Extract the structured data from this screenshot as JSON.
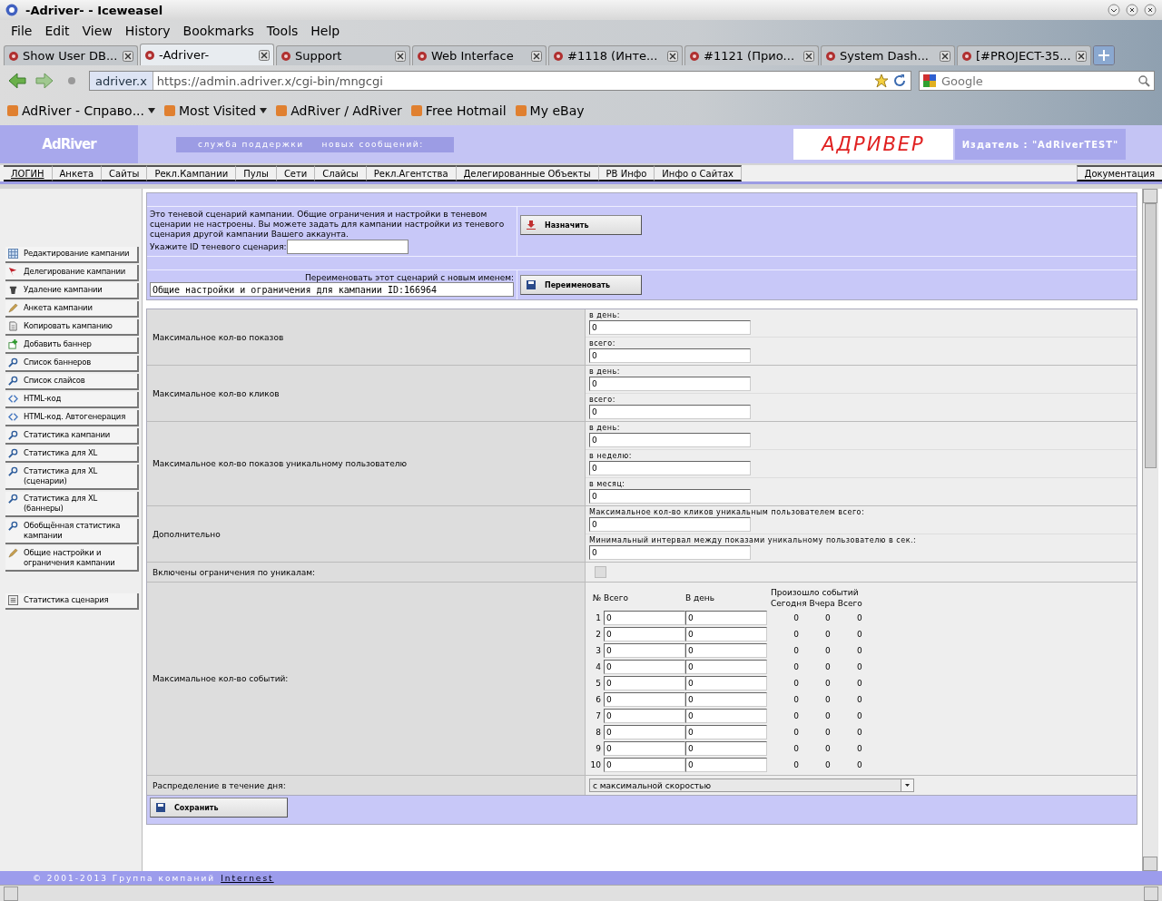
{
  "window": {
    "title": "-Adriver- - Iceweasel"
  },
  "menu": [
    "File",
    "Edit",
    "View",
    "History",
    "Bookmarks",
    "Tools",
    "Help"
  ],
  "tabs": [
    {
      "label": "Show User DB...",
      "selected": false
    },
    {
      "label": "-Adriver-",
      "selected": true
    },
    {
      "label": "Support",
      "selected": false
    },
    {
      "label": "Web Interface",
      "selected": false
    },
    {
      "label": "#1118 (Инте...",
      "selected": false
    },
    {
      "label": "#1121 (Прио...",
      "selected": false
    },
    {
      "label": "System Dash...",
      "selected": false
    },
    {
      "label": "[#PROJECT-35...",
      "selected": false
    }
  ],
  "address": {
    "site": "adriver.x",
    "url": "https://admin.adriver.x/cgi-bin/mngcgi"
  },
  "search": {
    "placeholder": "Google"
  },
  "bookmarks": [
    {
      "label": "AdRiver - Справо...",
      "has_menu": true
    },
    {
      "label": "Most Visited",
      "has_menu": true
    },
    {
      "label": "AdRiver / AdRiver",
      "has_menu": false
    },
    {
      "label": "Free Hotmail",
      "has_menu": false
    },
    {
      "label": "My eBay",
      "has_menu": false
    }
  ],
  "header": {
    "logo": "AdRiver",
    "support": "служба поддержки",
    "messages": "новых сообщений:",
    "brand": "АДРИВЕР",
    "publisher": "Издатель : \"AdRiverTEST\""
  },
  "nav": {
    "items": [
      {
        "label": "ЛОГИН",
        "selected": true
      },
      {
        "label": "Анкета",
        "selected": false
      },
      {
        "label": "Сайты",
        "selected": false
      },
      {
        "label": "Рекл.Кампании",
        "selected": false
      },
      {
        "label": "Пулы",
        "selected": false
      },
      {
        "label": "Сети",
        "selected": false
      },
      {
        "label": "Слайсы",
        "selected": false
      },
      {
        "label": "Рекл.Агентства",
        "selected": false
      },
      {
        "label": "Делегированные Объекты",
        "selected": false
      },
      {
        "label": "РВ Инфо",
        "selected": false
      },
      {
        "label": "Инфо о Сайтах",
        "selected": false
      }
    ],
    "docs": "Документация"
  },
  "sidebar": {
    "items": [
      {
        "label": "Редактирование кампании",
        "kind": "grid"
      },
      {
        "label": "Делегирование кампании",
        "kind": "flag"
      },
      {
        "label": "Удаление кампании",
        "kind": "trash"
      },
      {
        "label": "Анкета кампании",
        "kind": "pencil"
      },
      {
        "label": "Копировать кампанию",
        "kind": "page"
      },
      {
        "label": "Добавить баннер",
        "kind": "add"
      },
      {
        "label": "Список баннеров",
        "kind": "search"
      },
      {
        "label": "Список слайсов",
        "kind": "search"
      },
      {
        "label": "HTML-код",
        "kind": "code"
      },
      {
        "label": "HTML-код. Автогенерация",
        "kind": "code"
      },
      {
        "label": "Статистика кампании",
        "kind": "search"
      },
      {
        "label": "Статистика для XL",
        "kind": "search"
      },
      {
        "label": "Статистика для XL (сценарии)",
        "kind": "search"
      },
      {
        "label": "Статистика для XL (баннеры)",
        "kind": "search"
      },
      {
        "label": "Обобщённая статистика кампании",
        "kind": "search"
      },
      {
        "label": "Общие настройки и ограничения кампании",
        "kind": "pencil"
      }
    ],
    "extra_items": [
      {
        "label": "Статистика сценария",
        "kind": "list"
      }
    ]
  },
  "shadow": {
    "text": "Это теневой сценарий кампании. Общие ограничения и настройки в теневом сценарии не настроены. Вы можете задать для кампании настройки из теневого сценария другой кампании Вашего аккаунта.",
    "id_label": "Укажите ID теневого сценария:",
    "button": "Назначить"
  },
  "rename": {
    "label": "Переименовать этот сценарий с новым именем:",
    "value": "Общие настройки и ограничения для кампании ID:166964",
    "button": "Переименовать"
  },
  "limits": [
    {
      "label": "Максимальное кол-во показов",
      "fields": [
        {
          "label": "в день:",
          "value": "0"
        },
        {
          "label": "всего:",
          "value": "0"
        }
      ]
    },
    {
      "label": "Максимальное кол-во кликов",
      "fields": [
        {
          "label": "в день:",
          "value": "0"
        },
        {
          "label": "всего:",
          "value": "0"
        }
      ]
    },
    {
      "label": "Максимальное кол-во показов уникальному пользователю",
      "fields": [
        {
          "label": "в день:",
          "value": "0"
        },
        {
          "label": "в неделю:",
          "value": "0"
        },
        {
          "label": "в месяц:",
          "value": "0"
        }
      ]
    },
    {
      "label": "Дополнительно",
      "fields": [
        {
          "label": "Максимальное кол-во кликов уникальным пользователем всего:",
          "value": "0"
        },
        {
          "label": "Минимальный интервал между показами уникальному пользователю в сек.:",
          "value": "0"
        }
      ]
    }
  ],
  "uniques": {
    "label": "Включены ограничения по уникалам:",
    "checked": false
  },
  "events": {
    "label": "Максимальное кол-во событий:",
    "col_num": "№",
    "col_total": "Всего",
    "col_day": "В день",
    "col_happened": "Произошло событий",
    "col_today": "Сегодня",
    "col_yesterday": "Вчера",
    "col_all": "Всего",
    "rows": [
      {
        "n": "1",
        "total": "0",
        "day": "0",
        "today": "0",
        "yesterday": "0",
        "all": "0"
      },
      {
        "n": "2",
        "total": "0",
        "day": "0",
        "today": "0",
        "yesterday": "0",
        "all": "0"
      },
      {
        "n": "3",
        "total": "0",
        "day": "0",
        "today": "0",
        "yesterday": "0",
        "all": "0"
      },
      {
        "n": "4",
        "total": "0",
        "day": "0",
        "today": "0",
        "yesterday": "0",
        "all": "0"
      },
      {
        "n": "5",
        "total": "0",
        "day": "0",
        "today": "0",
        "yesterday": "0",
        "all": "0"
      },
      {
        "n": "6",
        "total": "0",
        "day": "0",
        "today": "0",
        "yesterday": "0",
        "all": "0"
      },
      {
        "n": "7",
        "total": "0",
        "day": "0",
        "today": "0",
        "yesterday": "0",
        "all": "0"
      },
      {
        "n": "8",
        "total": "0",
        "day": "0",
        "today": "0",
        "yesterday": "0",
        "all": "0"
      },
      {
        "n": "9",
        "total": "0",
        "day": "0",
        "today": "0",
        "yesterday": "0",
        "all": "0"
      },
      {
        "n": "10",
        "total": "0",
        "day": "0",
        "today": "0",
        "yesterday": "0",
        "all": "0"
      }
    ]
  },
  "distribution": {
    "label": "Распределение в течение дня:",
    "value": "с максимальной скоростью"
  },
  "save_button": "Сохранить",
  "footer": {
    "text": "© 2001-2013 Группа компаний",
    "link": "Internest"
  }
}
